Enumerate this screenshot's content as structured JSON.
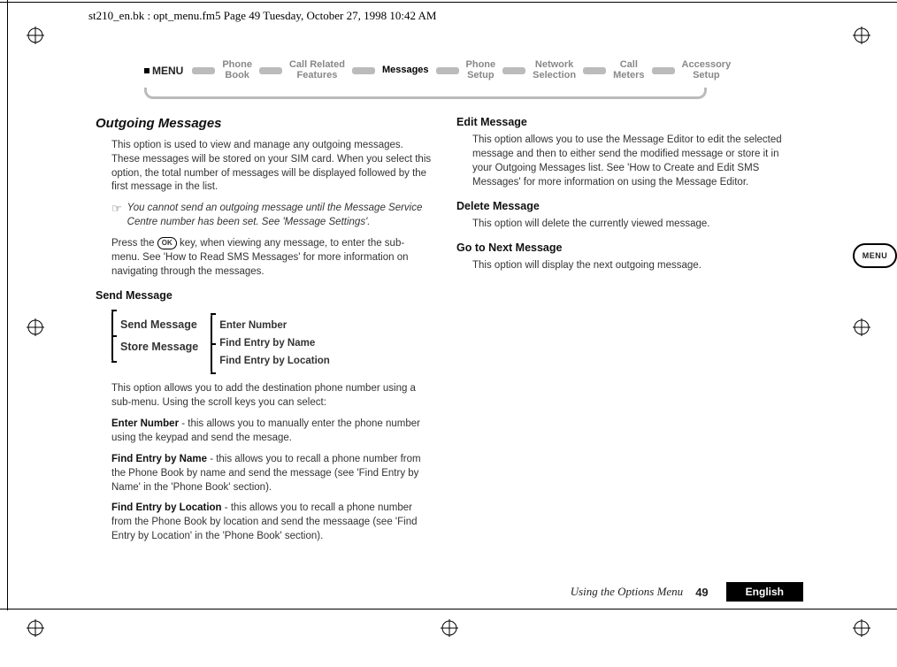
{
  "header_line": "st210_en.bk : opt_menu.fm5  Page 49  Tuesday, October 27, 1998  10:42 AM",
  "nav": {
    "menu_label": "MENU",
    "items": [
      "Phone\nBook",
      "Call Related\nFeatures",
      "Messages",
      "Phone\nSetup",
      "Network\nSelection",
      "Call\nMeters",
      "Accessory\nSetup"
    ],
    "active_index": 2
  },
  "left": {
    "h2": "Outgoing Messages",
    "p1": "This option is used to view and manage any outgoing messages. These messages will be stored on your SIM card. When you select this option, the total number of messages will be displayed followed by the first message in the list.",
    "note": "You cannot send an outgoing message until the Message Service Centre number has been set. See 'Message Settings'.",
    "p2a": "Press the ",
    "ok": "OK",
    "p2b": " key, when viewing any message, to enter the sub-menu. See 'How to Read SMS Messages' for more information on navigating through the messages.",
    "h3_send": "Send Message",
    "diagram": {
      "left": [
        "Send Message",
        "Store Message"
      ],
      "right": [
        "Enter Number",
        "Find Entry by Name",
        "Find Entry by Location"
      ]
    },
    "p3": "This option allows you to add the destination phone number using a sub-menu. Using the scroll keys you can select:",
    "enter_number_label": "Enter Number",
    "enter_number_text": " - this allows you to manually enter the phone number using the keypad and send the mesage.",
    "find_name_label": "Find Entry by Name",
    "find_name_text": " - this allows you to recall a phone number from the Phone Book by name and send the message (see 'Find Entry by Name' in the 'Phone Book' section).",
    "find_loc_label": "Find Entry by Location",
    "find_loc_text": " - this allows you to recall a phone number from the Phone Book by location and send the messaage (see 'Find Entry by Location' in the 'Phone Book' section)."
  },
  "right": {
    "h3_edit": "Edit Message",
    "p_edit": "This option allows you to use the Message Editor to edit the selected message and then to either send the modified message or store it in your Outgoing Messages list. See 'How to Create and Edit SMS Messages' for more information on using the Message Editor.",
    "h3_delete": "Delete Message",
    "p_delete": "This option will delete the currently viewed message.",
    "h3_next": "Go to Next Message",
    "p_next": "This option will display the next outgoing message."
  },
  "side_icon_label": "MENU",
  "footer": {
    "section": "Using the Options Menu",
    "page": "49",
    "lang": "English"
  }
}
